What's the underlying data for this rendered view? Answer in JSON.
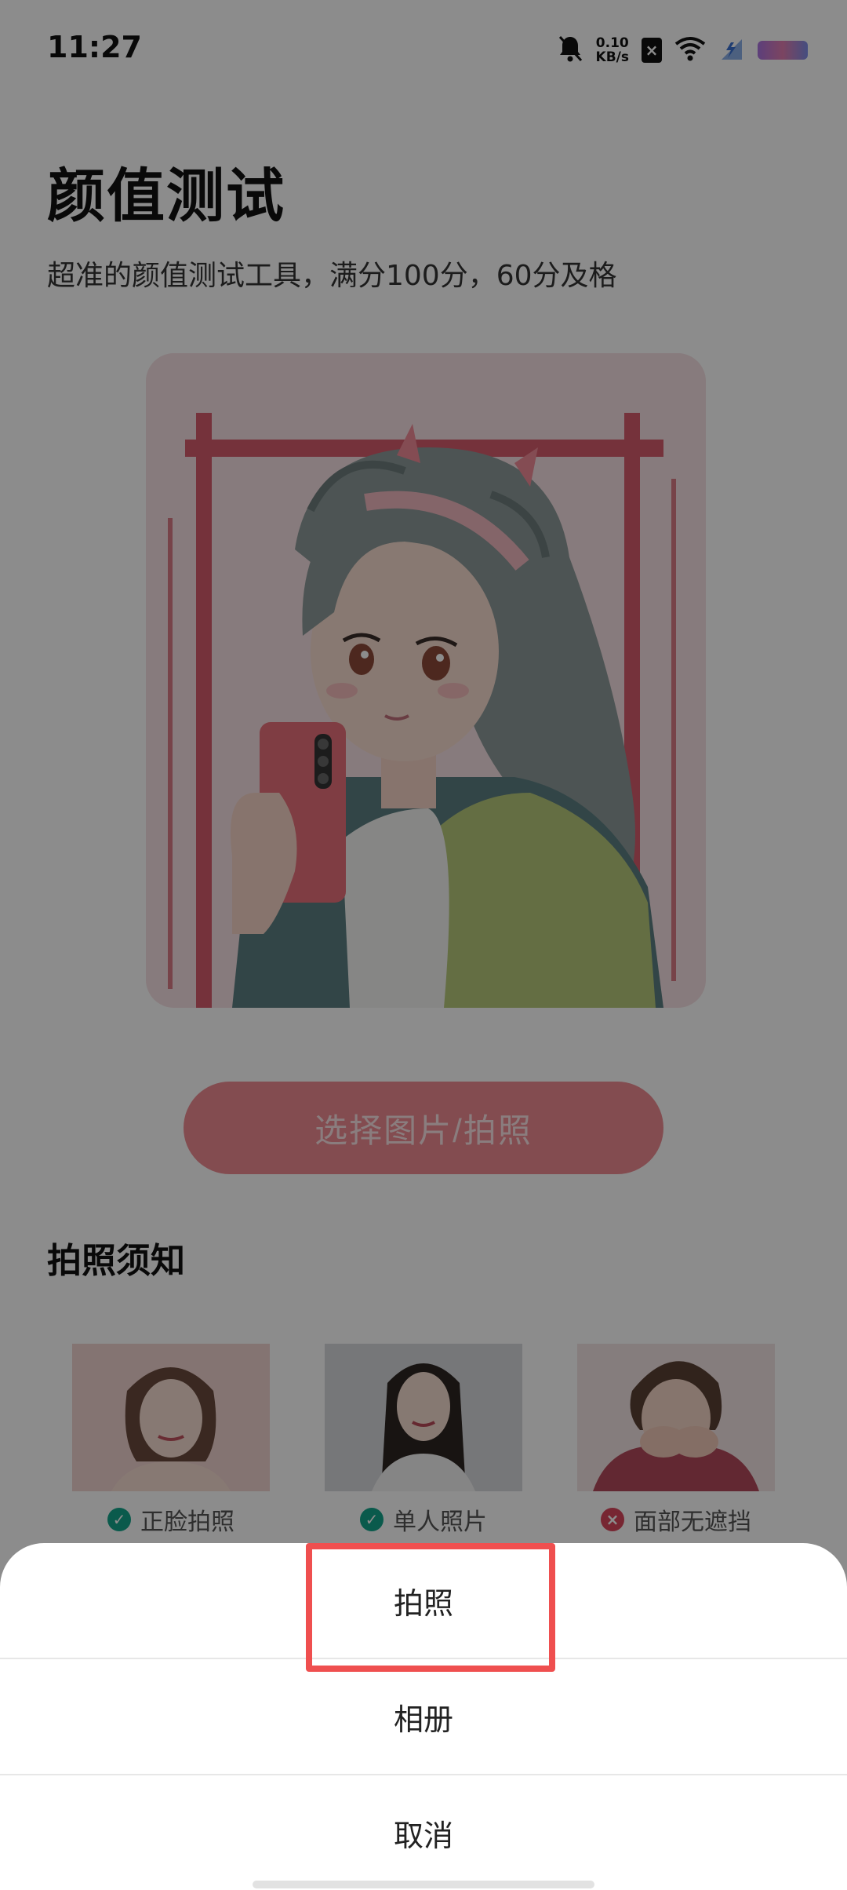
{
  "status_bar": {
    "time": "11:27",
    "net_speed_value": "0.10",
    "net_speed_unit": "KB/s",
    "icons": [
      "bell-muted-icon",
      "sim-x-icon",
      "wifi-icon",
      "data-icon",
      "battery-icon"
    ]
  },
  "page": {
    "title": "颜值测试",
    "subtitle": "超准的颜值测试工具，满分100分，60分及格"
  },
  "select_button": {
    "label": "选择图片/拍照"
  },
  "tips": {
    "title": "拍照须知",
    "items": [
      {
        "label": "正脸拍照",
        "status": "ok",
        "icon": "check-circle-icon"
      },
      {
        "label": "单人照片",
        "status": "ok",
        "icon": "check-circle-icon"
      },
      {
        "label": "面部无遮挡",
        "status": "bad",
        "icon": "cross-circle-icon"
      }
    ]
  },
  "action_sheet": {
    "items": [
      {
        "label": "拍照"
      },
      {
        "label": "相册"
      },
      {
        "label": "取消"
      }
    ]
  },
  "colors": {
    "accent": "#ee8b92",
    "ok": "#13a58a",
    "bad": "#d9465b",
    "highlight": "#ef4f4f"
  }
}
